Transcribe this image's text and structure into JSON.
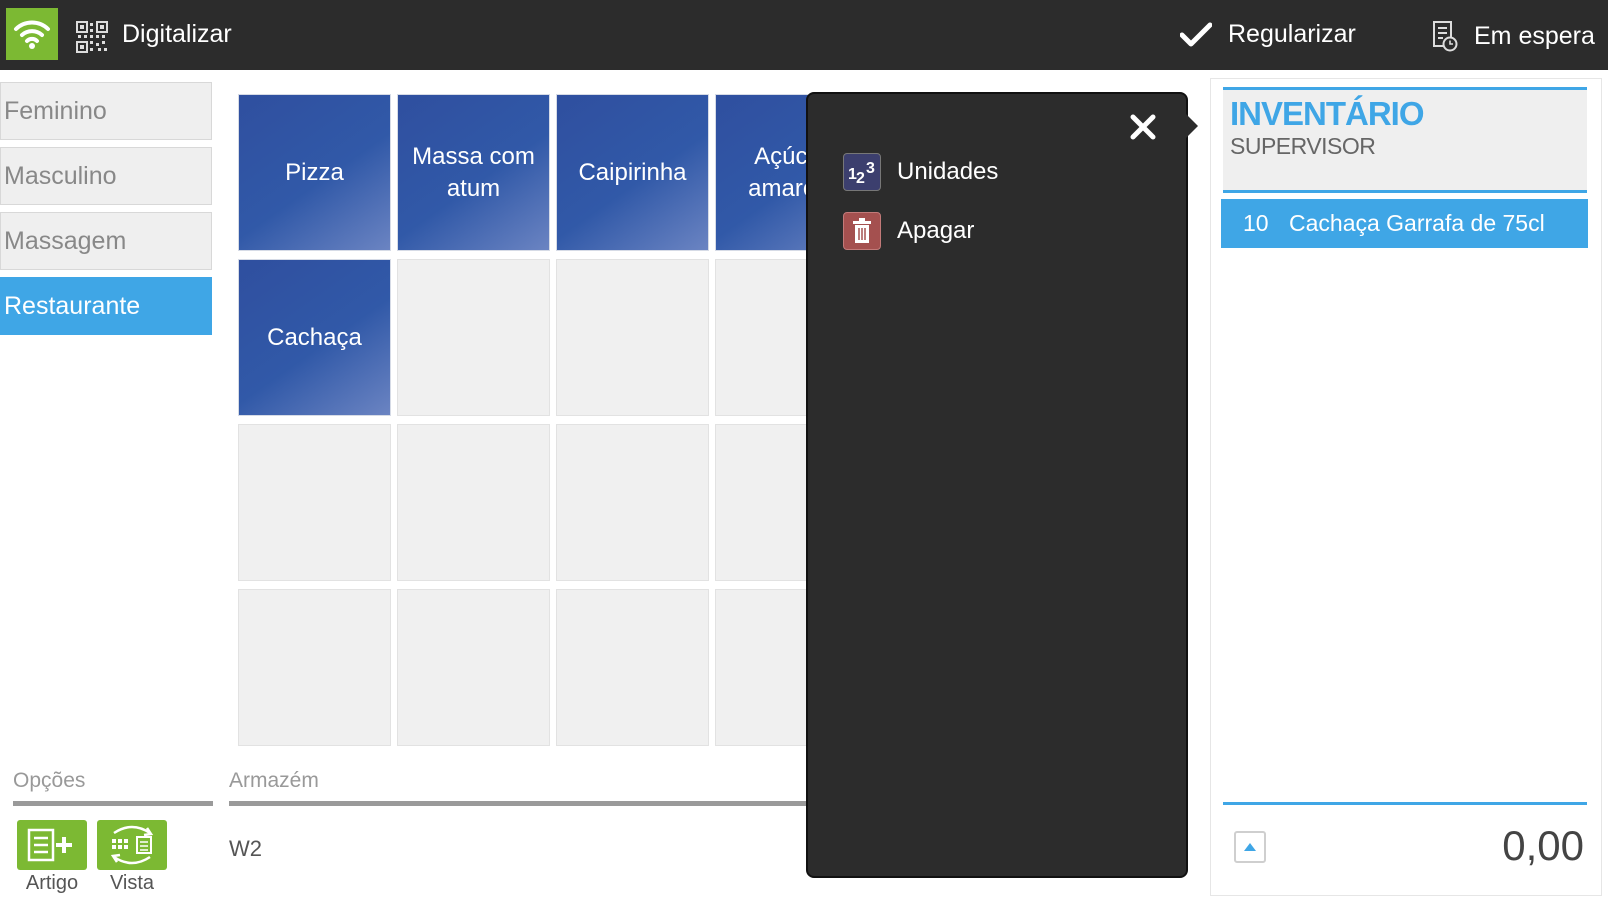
{
  "topbar": {
    "scan_label": "Digitalizar",
    "regularize_label": "Regularizar",
    "hold_label": "Em espera",
    "accent_color": "#7cb933"
  },
  "categories": [
    {
      "label": "Feminino",
      "active": false
    },
    {
      "label": "Masculino",
      "active": false
    },
    {
      "label": "Massagem",
      "active": false
    },
    {
      "label": "Restaurante",
      "active": true
    }
  ],
  "products": [
    {
      "label": "Pizza"
    },
    {
      "label": "Massa com atum"
    },
    {
      "label": "Caipirinha"
    },
    {
      "label": "Açúcar amarelo"
    },
    {
      "label": "Cachaça"
    }
  ],
  "options": {
    "label": "Opções",
    "article_label": "Artigo",
    "view_label": "Vista"
  },
  "warehouse": {
    "label": "Armazém",
    "value": "W2"
  },
  "popup": {
    "items": [
      {
        "label": "Unidades",
        "icon": "units-icon"
      },
      {
        "label": "Apagar",
        "icon": "trash-icon"
      }
    ]
  },
  "panel": {
    "title": "INVENTÁRIO",
    "subtitle": "SUPERVISOR",
    "line": {
      "qty": "10",
      "name": "Cachaça Garrafa de 75cl"
    },
    "total": "0,00",
    "accent_color": "#3fa6e6"
  }
}
